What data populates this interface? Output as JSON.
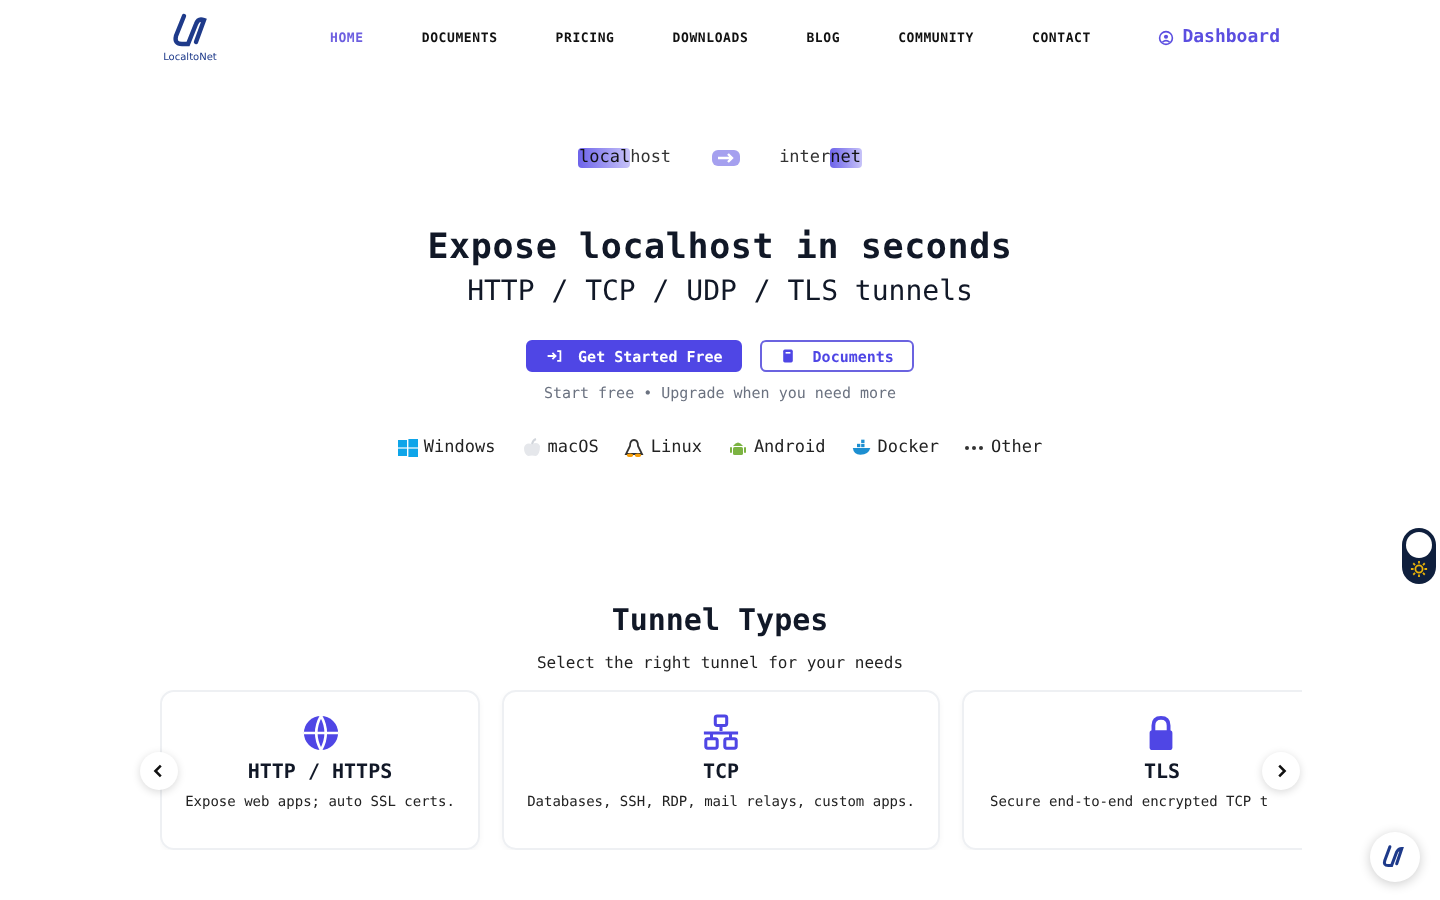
{
  "logo": {
    "text": "LocaltoNet"
  },
  "nav": [
    {
      "label": "HOME",
      "selected": true
    },
    {
      "label": "DOCUMENTS",
      "selected": false
    },
    {
      "label": "PRICING",
      "selected": false
    },
    {
      "label": "DOWNLOADS",
      "selected": false
    },
    {
      "label": "BLOG",
      "selected": false
    },
    {
      "label": "COMMUNITY",
      "selected": false
    },
    {
      "label": "CONTACT",
      "selected": false
    }
  ],
  "dashboard": {
    "label": "Dashboard"
  },
  "flow": {
    "from": [
      {
        "text": "local",
        "highlighted": true
      },
      {
        "text": "host",
        "highlighted": false
      }
    ],
    "to": [
      {
        "text": "inter",
        "highlighted": false
      },
      {
        "text": "net",
        "highlighted": true
      }
    ]
  },
  "hero": {
    "title": "Expose localhost in seconds",
    "subtitle": "HTTP / TCP / UDP / TLS tunnels",
    "buttons": [
      {
        "label": "Get Started Free",
        "kind": "primary"
      },
      {
        "label": "Documents",
        "kind": "secondary"
      }
    ],
    "note": "Start free • Upgrade when you need more"
  },
  "platforms": [
    {
      "label": "Windows",
      "kind": "windows"
    },
    {
      "label": "macOS",
      "kind": "apple"
    },
    {
      "label": "Linux",
      "kind": "linux"
    },
    {
      "label": "Android",
      "kind": "android"
    },
    {
      "label": "Docker",
      "kind": "docker"
    },
    {
      "label": "Other",
      "kind": "other"
    }
  ],
  "section": {
    "title": "Tunnel Types",
    "subtitle": "Select the right tunnel for your needs"
  },
  "cards": [
    {
      "kind": "globe",
      "title": "HTTP / HTTPS",
      "text": "Expose web apps; auto SSL certs."
    },
    {
      "kind": "network",
      "title": "TCP",
      "text": "Databases, SSH, RDP, mail relays, custom apps."
    },
    {
      "kind": "lock",
      "title": "TLS",
      "text": "Secure end-to-end encrypted TCP t"
    }
  ],
  "theme_toggle": {
    "on": true
  }
}
